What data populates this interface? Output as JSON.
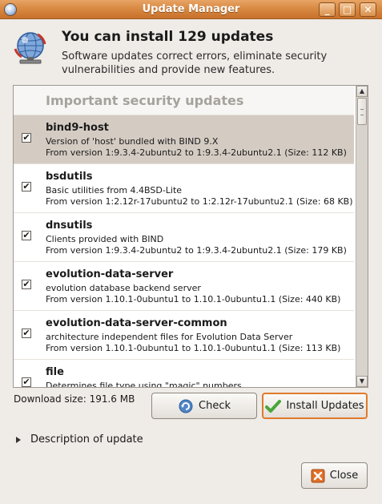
{
  "window": {
    "title": "Update Manager",
    "minimize_glyph": "_",
    "maximize_glyph": "□",
    "close_glyph": "✕"
  },
  "header": {
    "title": "You can install 129 updates",
    "subtitle": "Software updates correct errors, eliminate security vulnerabilities and provide new features."
  },
  "list": {
    "section": "Important security updates",
    "items": [
      {
        "name": "bind9-host",
        "desc": "Version of 'host' bundled with BIND 9.X",
        "version": "From version 1:9.3.4-2ubuntu2 to 1:9.3.4-2ubuntu2.1 (Size: 112 KB)",
        "checked": true,
        "selected": true
      },
      {
        "name": "bsdutils",
        "desc": "Basic utilities from 4.4BSD-Lite",
        "version": "From version 1:2.12r-17ubuntu2 to 1:2.12r-17ubuntu2.1 (Size: 68 KB)",
        "checked": true,
        "selected": false
      },
      {
        "name": "dnsutils",
        "desc": "Clients provided with BIND",
        "version": "From version 1:9.3.4-2ubuntu2 to 1:9.3.4-2ubuntu2.1 (Size: 179 KB)",
        "checked": true,
        "selected": false
      },
      {
        "name": "evolution-data-server",
        "desc": "evolution database backend server",
        "version": "From version 1.10.1-0ubuntu1 to 1.10.1-0ubuntu1.1 (Size: 440 KB)",
        "checked": true,
        "selected": false
      },
      {
        "name": "evolution-data-server-common",
        "desc": "architecture independent files for Evolution Data Server",
        "version": "From version 1.10.1-0ubuntu1 to 1.10.1-0ubuntu1.1 (Size: 113 KB)",
        "checked": true,
        "selected": false
      },
      {
        "name": "file",
        "desc": "Determines file type using \"magic\" numbers",
        "version": "",
        "checked": true,
        "selected": false
      }
    ]
  },
  "footer": {
    "download_size": "Download size: 191.6 MB",
    "check_label": "Check",
    "install_label": "Install Updates",
    "description_label": "Description of update",
    "close_label": "Close"
  },
  "colors": {
    "titlebar": "#d98a43",
    "selection": "#d4ccc3",
    "install_focus": "#e07a2b"
  }
}
